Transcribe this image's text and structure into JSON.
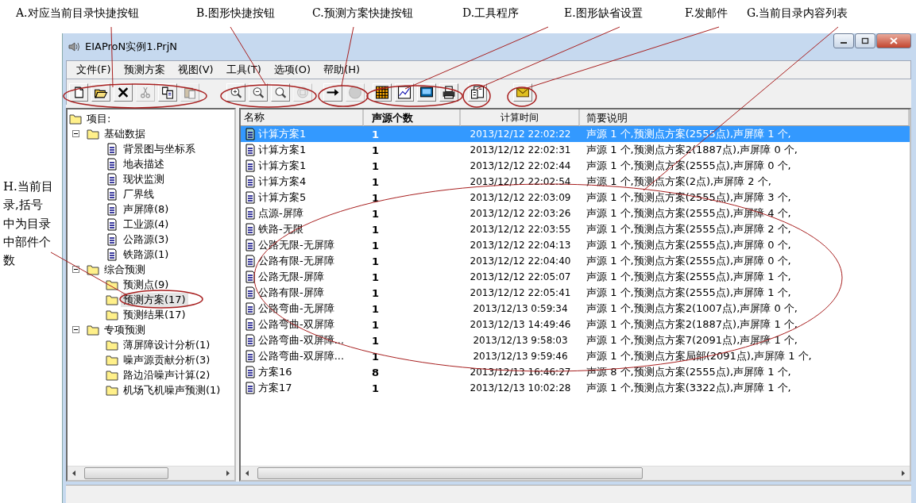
{
  "annotations": [
    {
      "text": "A.对应当前目录快捷按钮"
    },
    {
      "text": "B.图形快捷按钮"
    },
    {
      "text": "C.预测方案快捷按钮"
    },
    {
      "text": "D.工具程序"
    },
    {
      "text": "E.图形缺省设置"
    },
    {
      "text": "F.发邮件"
    },
    {
      "text": "G.当前目录内容列表"
    }
  ],
  "side_annotation": {
    "text": "H.当前目录,括号中为目录中部件个数"
  },
  "window": {
    "title": "EIAProN实例1.PrjN"
  },
  "menu": [
    "文件(F)",
    "预测方案",
    "视图(V)",
    "工具(T)",
    "选项(O)",
    "帮助(H)"
  ],
  "toolbar": [
    [
      {
        "kind": "new",
        "disabled": false
      },
      {
        "kind": "open",
        "disabled": false
      },
      {
        "kind": "delete",
        "disabled": false
      },
      {
        "kind": "cut",
        "disabled": true
      },
      {
        "kind": "copy",
        "disabled": false
      },
      {
        "kind": "paste",
        "disabled": true
      }
    ],
    [
      {
        "kind": "zoom_in",
        "disabled": false
      },
      {
        "kind": "zoom_out",
        "disabled": false
      },
      {
        "kind": "zoom",
        "disabled": false
      },
      {
        "kind": "zoom_fit",
        "disabled": true
      }
    ],
    [
      {
        "kind": "arrow",
        "disabled": false
      },
      {
        "kind": "stop",
        "disabled": true
      }
    ],
    [
      {
        "kind": "grid",
        "disabled": false
      },
      {
        "kind": "chart",
        "disabled": false
      },
      {
        "kind": "monitor",
        "disabled": false
      },
      {
        "kind": "printer",
        "disabled": false
      }
    ],
    [
      {
        "kind": "properties",
        "disabled": false
      }
    ],
    [
      {
        "kind": "mail",
        "disabled": false
      }
    ]
  ],
  "tree": [
    {
      "label": "项目:",
      "kind": "folder",
      "selected": false,
      "children": [
        {
          "label": "基础数据",
          "kind": "folder",
          "expanded": true,
          "selected": false,
          "children": [
            {
              "label": "背景图与坐标系",
              "kind": "doc",
              "selected": false
            },
            {
              "label": "地表描述",
              "kind": "doc",
              "selected": false
            },
            {
              "label": "现状监测",
              "kind": "doc",
              "selected": false
            },
            {
              "label": "厂界线",
              "kind": "doc",
              "selected": false
            },
            {
              "label": "声屏障(8)",
              "kind": "doc",
              "selected": false
            },
            {
              "label": "工业源(4)",
              "kind": "doc",
              "selected": false
            },
            {
              "label": "公路源(3)",
              "kind": "doc",
              "selected": false
            },
            {
              "label": "铁路源(1)",
              "kind": "doc",
              "selected": false
            }
          ]
        },
        {
          "label": "综合预测",
          "kind": "folder",
          "expanded": true,
          "selected": false,
          "children": [
            {
              "label": "预测点(9)",
              "kind": "folder",
              "selected": false
            },
            {
              "label": "预测方案(17)",
              "kind": "folder",
              "selected": true
            },
            {
              "label": "预测结果(17)",
              "kind": "folder",
              "selected": false
            }
          ]
        },
        {
          "label": "专项预测",
          "kind": "folder",
          "expanded": true,
          "selected": false,
          "children": [
            {
              "label": "薄屏障设计分析(1)",
              "kind": "folder",
              "selected": false
            },
            {
              "label": "噪声源贡献分析(3)",
              "kind": "folder",
              "selected": false
            },
            {
              "label": "路边沿噪声计算(2)",
              "kind": "folder",
              "selected": false
            },
            {
              "label": "机场飞机噪声预测(1)",
              "kind": "folder",
              "selected": false
            }
          ]
        }
      ]
    }
  ],
  "table": {
    "columns": [
      "名称",
      "声源个数",
      "计算时间",
      "简要说明"
    ],
    "rows": [
      {
        "name": "计算方案1",
        "sources": "1",
        "time": "2013/12/12 22:02:22",
        "summary": "声源 1 个,预测点方案(2555点),声屏障 1 个,",
        "selected": true
      },
      {
        "name": "计算方案1",
        "sources": "1",
        "time": "2013/12/12 22:02:31",
        "summary": "声源 1 个,预测点方案2(1887点),声屏障 0 个,",
        "selected": false
      },
      {
        "name": "计算方案1",
        "sources": "1",
        "time": "2013/12/12 22:02:44",
        "summary": "声源 1 个,预测点方案(2555点),声屏障 0 个,",
        "selected": false
      },
      {
        "name": "计算方案4",
        "sources": "1",
        "time": "2013/12/12 22:02:54",
        "summary": "声源 1 个,预测点方案(2点),声屏障 2 个,",
        "selected": false
      },
      {
        "name": "计算方案5",
        "sources": "1",
        "time": "2013/12/12 22:03:09",
        "summary": "声源 1 个,预测点方案(2555点),声屏障 3 个,",
        "selected": false
      },
      {
        "name": "点源-屏障",
        "sources": "1",
        "time": "2013/12/12 22:03:26",
        "summary": "声源 1 个,预测点方案(2555点),声屏障 4 个,",
        "selected": false
      },
      {
        "name": "铁路-无限",
        "sources": "1",
        "time": "2013/12/12 22:03:55",
        "summary": "声源 1 个,预测点方案(2555点),声屏障 2 个,",
        "selected": false
      },
      {
        "name": "公路无限-无屏障",
        "sources": "1",
        "time": "2013/12/12 22:04:13",
        "summary": "声源 1 个,预测点方案(2555点),声屏障 0 个,",
        "selected": false
      },
      {
        "name": "公路有限-无屏障",
        "sources": "1",
        "time": "2013/12/12 22:04:40",
        "summary": "声源 1 个,预测点方案(2555点),声屏障 0 个,",
        "selected": false
      },
      {
        "name": "公路无限-屏障",
        "sources": "1",
        "time": "2013/12/12 22:05:07",
        "summary": "声源 1 个,预测点方案(2555点),声屏障 1 个,",
        "selected": false
      },
      {
        "name": "公路有限-屏障",
        "sources": "1",
        "time": "2013/12/12 22:05:41",
        "summary": "声源 1 个,预测点方案(2555点),声屏障 1 个,",
        "selected": false
      },
      {
        "name": "公路弯曲-无屏障",
        "sources": "1",
        "time": "2013/12/13 0:59:34",
        "summary": "声源 1 个,预测点方案2(1007点),声屏障 0 个,",
        "selected": false
      },
      {
        "name": "公路弯曲-双屏障",
        "sources": "1",
        "time": "2013/12/13 14:49:46",
        "summary": "声源 1 个,预测点方案2(1887点),声屏障 1 个,",
        "selected": false
      },
      {
        "name": "公路弯曲-双屏障...",
        "sources": "1",
        "time": "2013/12/13 9:58:03",
        "summary": "声源 1 个,预测点方案7(2091点),声屏障 1 个,",
        "selected": false
      },
      {
        "name": "公路弯曲-双屏障...",
        "sources": "1",
        "time": "2013/12/13 9:59:46",
        "summary": "声源 1 个,预测点方案局部(2091点),声屏障 1 个,",
        "selected": false
      },
      {
        "name": "方案16",
        "sources": "8",
        "time": "2013/12/13 16:46:27",
        "summary": "声源 8 个,预测点方案(2555点),声屏障 1 个,",
        "selected": false
      },
      {
        "name": "方案17",
        "sources": "1",
        "time": "2013/12/13 10:02:28",
        "summary": "声源 1 个,预测点方案(3322点),声屏障 1 个,",
        "selected": false
      }
    ]
  }
}
